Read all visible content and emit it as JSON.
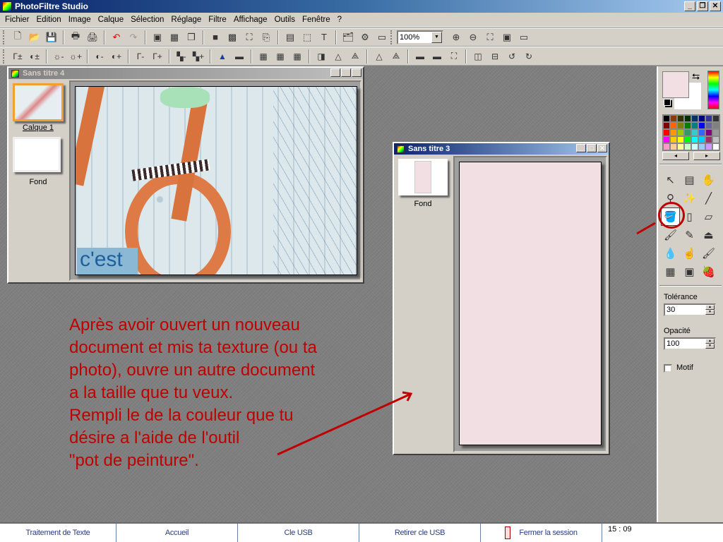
{
  "app": {
    "title": "PhotoFiltre Studio"
  },
  "window_controls": {
    "minimize": "_",
    "restore": "🗗",
    "close": "✕"
  },
  "menu": [
    "Fichier",
    "Edition",
    "Image",
    "Calque",
    "Sélection",
    "Réglage",
    "Filtre",
    "Affichage",
    "Outils",
    "Fenêtre",
    "?"
  ],
  "toolbar1": {
    "buttons": [
      {
        "name": "new-document",
        "glyph": "🗋"
      },
      {
        "name": "open",
        "glyph": "📂"
      },
      {
        "name": "save",
        "glyph": "💾"
      },
      {
        "name": "print",
        "glyph": "🖶"
      },
      {
        "name": "scan",
        "glyph": "🖨"
      },
      {
        "name": "undo",
        "glyph": "↶"
      },
      {
        "name": "redo",
        "glyph": "↷"
      },
      {
        "name": "duplicate",
        "glyph": "▣"
      },
      {
        "name": "transparency",
        "glyph": "▦"
      },
      {
        "name": "copy-image",
        "glyph": "❐"
      },
      {
        "name": "gray-square",
        "glyph": "■"
      },
      {
        "name": "color-palette",
        "glyph": "▩"
      },
      {
        "name": "mask",
        "glyph": "⛶"
      },
      {
        "name": "paste-as",
        "glyph": "⎘"
      },
      {
        "name": "crop-frame",
        "glyph": "▤"
      },
      {
        "name": "selection",
        "glyph": "⬚"
      },
      {
        "name": "text",
        "glyph": "T"
      },
      {
        "name": "explorer",
        "glyph": "🗂"
      },
      {
        "name": "plugins",
        "glyph": "⚙"
      },
      {
        "name": "window-list",
        "glyph": "▭"
      }
    ],
    "zoom_value": "100%",
    "zoom_buttons": [
      {
        "name": "zoom-in",
        "glyph": "⊕"
      },
      {
        "name": "zoom-out",
        "glyph": "⊖"
      },
      {
        "name": "fit",
        "glyph": "⛶"
      },
      {
        "name": "actual-size",
        "glyph": "▣"
      },
      {
        "name": "slideshow",
        "glyph": "▭"
      }
    ]
  },
  "toolbar2": {
    "buttons": [
      {
        "name": "auto-levels",
        "glyph": "Γ±"
      },
      {
        "name": "auto-contrast",
        "glyph": "◐±"
      },
      {
        "name": "brightness-minus",
        "glyph": "☼-"
      },
      {
        "name": "brightness-plus",
        "glyph": "☼+"
      },
      {
        "name": "contrast-minus",
        "glyph": "◐-"
      },
      {
        "name": "contrast-plus",
        "glyph": "◐+"
      },
      {
        "name": "gamma-minus",
        "glyph": "Γ-"
      },
      {
        "name": "gamma-plus",
        "glyph": "Γ+"
      },
      {
        "name": "saturation-minus",
        "glyph": "▚-"
      },
      {
        "name": "saturation-plus",
        "glyph": "▚+"
      },
      {
        "name": "histogram",
        "glyph": "▲"
      },
      {
        "name": "rgb-balance",
        "glyph": "▬"
      },
      {
        "name": "grid-gray",
        "glyph": "▦"
      },
      {
        "name": "grid-brown",
        "glyph": "▦"
      },
      {
        "name": "grid-green",
        "glyph": "▦"
      },
      {
        "name": "transparent-color",
        "glyph": "◨"
      },
      {
        "name": "blur",
        "glyph": "△"
      },
      {
        "name": "blur-more",
        "glyph": "⟁"
      },
      {
        "name": "sharpen",
        "glyph": "△"
      },
      {
        "name": "sharpen-more",
        "glyph": "⟁"
      },
      {
        "name": "gradient-rainbow",
        "glyph": "▬"
      },
      {
        "name": "gradient-blue",
        "glyph": "▬"
      },
      {
        "name": "stamp-effect",
        "glyph": "⛶"
      },
      {
        "name": "flip-horizontal",
        "glyph": "◫"
      },
      {
        "name": "flip-vertical",
        "glyph": "⊟"
      },
      {
        "name": "rotate-left",
        "glyph": "↺"
      },
      {
        "name": "rotate-right",
        "glyph": "↻"
      }
    ]
  },
  "doc4": {
    "title": "Sans titre 4",
    "layers": [
      {
        "label": "Calque 1",
        "selected": true
      },
      {
        "label": "Fond",
        "selected": false
      }
    ],
    "overlay_text": "c'est"
  },
  "doc3": {
    "title": "Sans titre 3",
    "layers": [
      {
        "label": "Fond"
      }
    ],
    "fill_color": "#f1dfe3"
  },
  "colors": {
    "foreground": "#f1dfe3",
    "background": "#ffffff",
    "palette": [
      "#000000",
      "#8b3a0b",
      "#333300",
      "#003300",
      "#003366",
      "#000080",
      "#333399",
      "#333333",
      "#800000",
      "#ff6600",
      "#808000",
      "#008000",
      "#008080",
      "#0000ff",
      "#666699",
      "#808080",
      "#ff0000",
      "#ff9900",
      "#99cc00",
      "#339966",
      "#33cccc",
      "#3366ff",
      "#800080",
      "#999999",
      "#ff00ff",
      "#ffcc00",
      "#ffff00",
      "#00ff00",
      "#00ffff",
      "#00ccff",
      "#993366",
      "#c0c0c0",
      "#ff99cc",
      "#ffcc99",
      "#ffff99",
      "#ccffcc",
      "#ccffff",
      "#99ccff",
      "#cc99ff",
      "#ffffff"
    ]
  },
  "tools": [
    {
      "name": "pointer",
      "glyph": "↖"
    },
    {
      "name": "selection-panel",
      "glyph": "▤"
    },
    {
      "name": "hand",
      "glyph": "✋"
    },
    {
      "name": "eyedropper",
      "glyph": "⚲"
    },
    {
      "name": "magic-wand",
      "glyph": "✨"
    },
    {
      "name": "line",
      "glyph": "╱"
    },
    {
      "name": "paint-bucket",
      "glyph": "🪣",
      "selected": true
    },
    {
      "name": "spray",
      "glyph": "▯"
    },
    {
      "name": "eraser",
      "glyph": "▱"
    },
    {
      "name": "brush",
      "glyph": "🖌"
    },
    {
      "name": "advanced-brush",
      "glyph": "✎"
    },
    {
      "name": "clone-stamp",
      "glyph": "⏏"
    },
    {
      "name": "blur-drop",
      "glyph": "💧"
    },
    {
      "name": "smudge-finger",
      "glyph": "☝"
    },
    {
      "name": "paint-roller",
      "glyph": "🖌"
    },
    {
      "name": "warp-grid",
      "glyph": "▦"
    },
    {
      "name": "portrait",
      "glyph": "▣"
    },
    {
      "name": "strawberry",
      "glyph": "🍓"
    }
  ],
  "tool_options": {
    "tolerance_label": "Tolérance",
    "tolerance_value": "30",
    "opacity_label": "Opacité",
    "opacity_value": "100",
    "pattern_label": "Motif",
    "pattern_checked": false
  },
  "annotation": {
    "text": "Après avoir ouvert un nouveau\ndocument et mis ta texture (ou ta\nphoto), ouvre un autre document\na la taille que tu veux.\nRempli le de la couleur que tu\ndésire a l'aide de l'outil\n\"pot de peinture\".",
    "color": "#c00000"
  },
  "taskbar": {
    "buttons": [
      "Traitement de Texte",
      "Accueil",
      "Cle USB",
      "Retirer cle USB",
      "Fermer la session"
    ],
    "clock": "15 : 09"
  }
}
